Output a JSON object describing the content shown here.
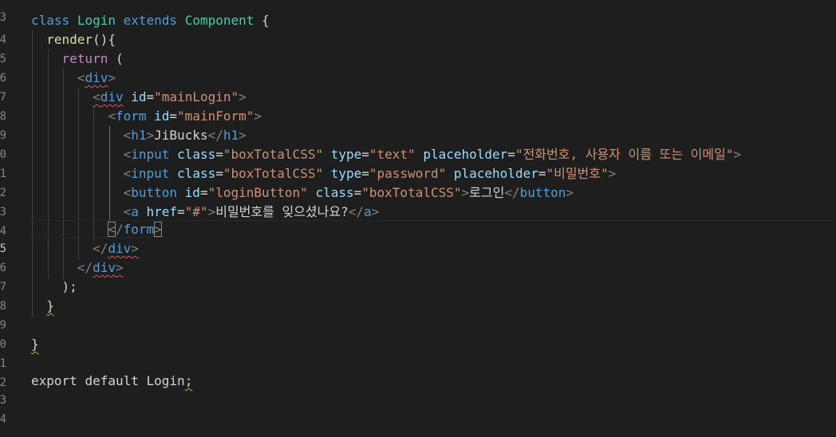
{
  "editor": {
    "line_numbers": [
      "3",
      "4",
      "5",
      "6",
      "7",
      "8",
      "9",
      "0",
      "1",
      "2",
      "3",
      "4",
      "5",
      "6",
      "7",
      "8",
      "9",
      "0",
      "1",
      "2",
      "3",
      "4"
    ],
    "active_line_index": 12,
    "colors": {
      "background": "#1e1e1e",
      "keyword": "#569cd6",
      "control": "#c586c0",
      "class_name": "#4ec9b0",
      "function": "#dcdcaa",
      "attribute": "#9cdcfe",
      "string": "#ce9178",
      "bracket": "#808080",
      "error_squiggle": "#f14c4c"
    },
    "code": {
      "l1": {
        "kw_class": "class",
        "name": "Login",
        "kw_extends": "extends",
        "base": "Component",
        "brace": "{"
      },
      "l2": {
        "fn": "render",
        "parens": "(){"
      },
      "l3": {
        "kw": "return",
        "paren": "("
      },
      "l4": {
        "tag": "div"
      },
      "l5": {
        "tag": "div",
        "attr": "id",
        "value": "\"mainLogin\""
      },
      "l6": {
        "tag": "form",
        "attr": "id",
        "value": "\"mainForm\""
      },
      "l7": {
        "tag": "h1",
        "text": "JiBucks",
        "close_tag": "h1"
      },
      "l8": {
        "tag": "input",
        "attr1": "class",
        "val1": "\"boxTotalCSS\"",
        "attr2": "type",
        "val2": "\"text\"",
        "attr3": "placeholder",
        "val3": "\"전화번호, 사용자 이름 또는 이메일\""
      },
      "l9": {
        "tag": "input",
        "attr1": "class",
        "val1": "\"boxTotalCSS\"",
        "attr2": "type",
        "val2": "\"password\"",
        "attr3": "placeholder",
        "val3": "\"비밀번호\""
      },
      "l10": {
        "tag": "button",
        "attr1": "id",
        "val1": "\"loginButton\"",
        "attr2": "class",
        "val2": "\"boxTotalCSS\"",
        "text": "로그인",
        "close_tag": "button"
      },
      "l11": {
        "tag": "a",
        "attr": "href",
        "value": "\"#\"",
        "text": "비밀번호를 잊으셨나요?",
        "close_tag": "a"
      },
      "l12": {
        "close_tag": "form"
      },
      "l13": {
        "close_tag": "div"
      },
      "l14": {
        "close_tag": "div"
      },
      "l15": {
        "text": ");"
      },
      "l16": {
        "text": "}"
      },
      "l18": {
        "text": "}"
      },
      "l20": {
        "kw_export": "export",
        "kw_default": "default",
        "name": "Login",
        "semi": ";"
      }
    }
  }
}
